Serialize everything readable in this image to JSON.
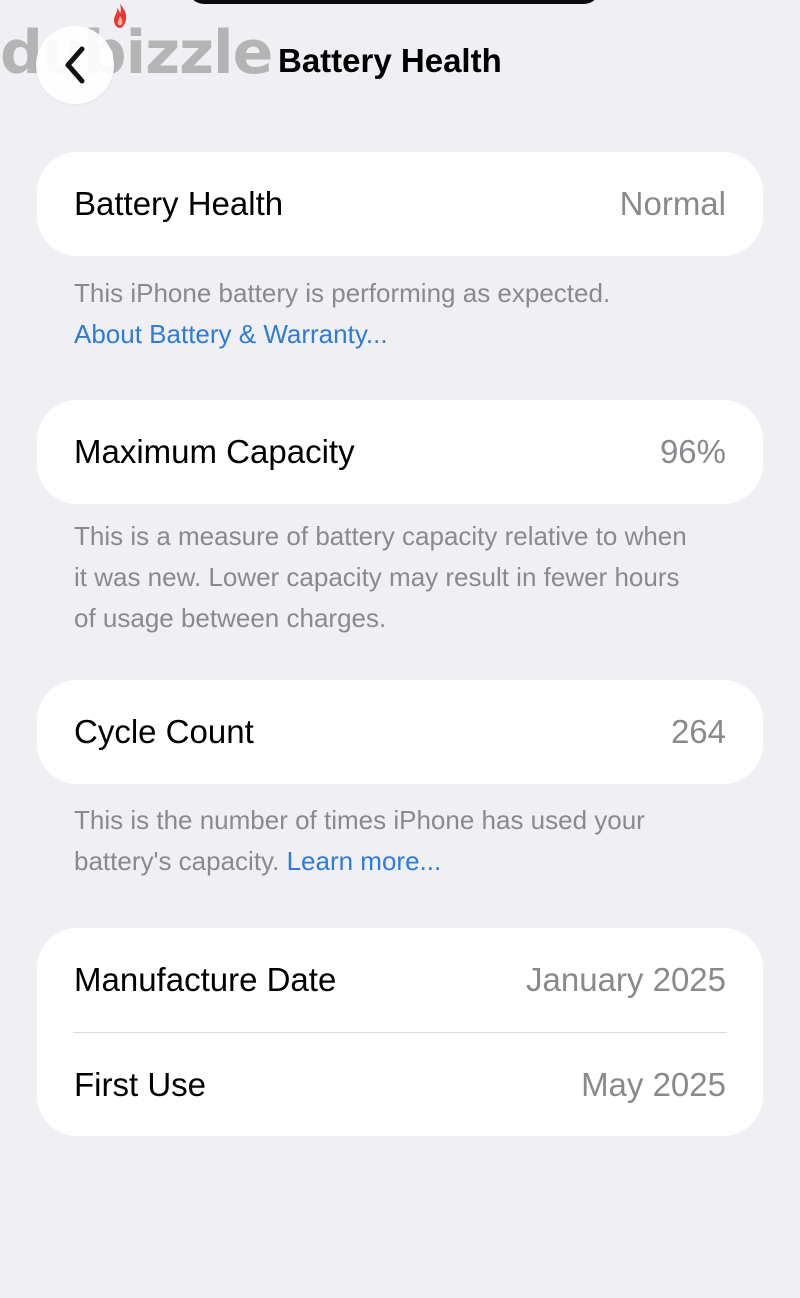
{
  "watermark": "dubizzle",
  "header": {
    "title": "Battery Health",
    "back_icon": "chevron-left-icon"
  },
  "battery_health": {
    "label": "Battery Health",
    "value": "Normal",
    "note": "This iPhone battery is performing as expected.",
    "link": "About Battery & Warranty..."
  },
  "maximum_capacity": {
    "label": "Maximum Capacity",
    "value": "96%",
    "note": "This is a measure of battery capacity relative to when it was new. Lower capacity may result in fewer hours of usage between charges."
  },
  "cycle_count": {
    "label": "Cycle Count",
    "value": "264",
    "note": "This is the number of times iPhone has used your battery's capacity.",
    "link": "Learn more..."
  },
  "dates": {
    "manufacture_label": "Manufacture Date",
    "manufacture_value": "January 2025",
    "first_use_label": "First Use",
    "first_use_value": "May 2025"
  },
  "colors": {
    "background": "#efeff4",
    "card": "#ffffff",
    "secondary_text": "#8a8a8e",
    "link": "#2f7bd8",
    "watermark_flame": "#e53935"
  }
}
